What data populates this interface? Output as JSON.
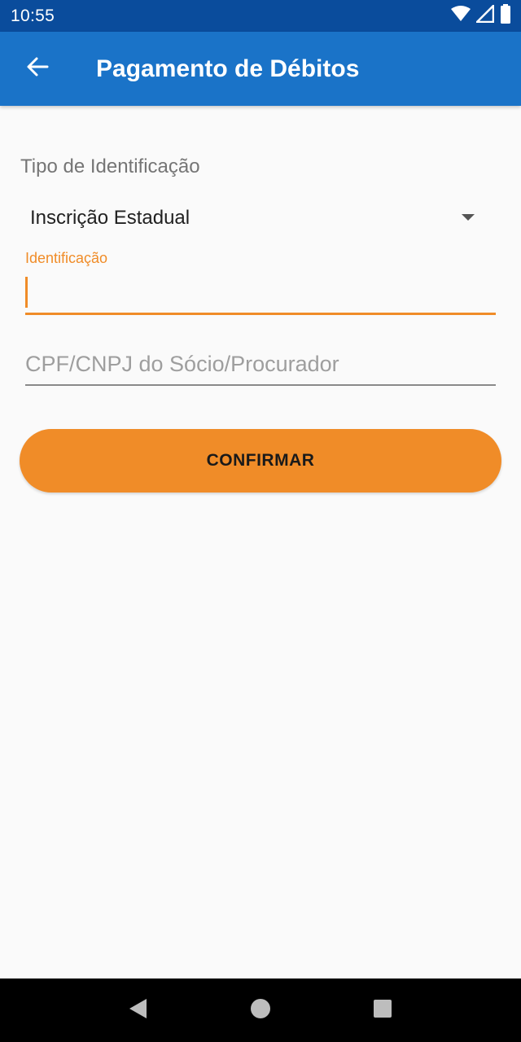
{
  "status_bar": {
    "time": "10:55",
    "icons": [
      "wifi-icon",
      "signal-icon",
      "battery-icon"
    ]
  },
  "app_bar": {
    "back_icon": "arrow-left-icon",
    "title": "Pagamento de Débitos",
    "background_color": "#1a73c8"
  },
  "form": {
    "type_label": "Tipo de Identificação",
    "type_selected": "Inscrição Estadual",
    "identification_label": "Identificação",
    "identification_value": "",
    "partner_placeholder": "CPF/CNPJ do Sócio/Procurador",
    "confirm_label": "CONFIRMAR",
    "accent_color": "#f08c28"
  },
  "nav_bar": {
    "icons": [
      "back-triangle-icon",
      "home-circle-icon",
      "recents-square-icon"
    ]
  }
}
